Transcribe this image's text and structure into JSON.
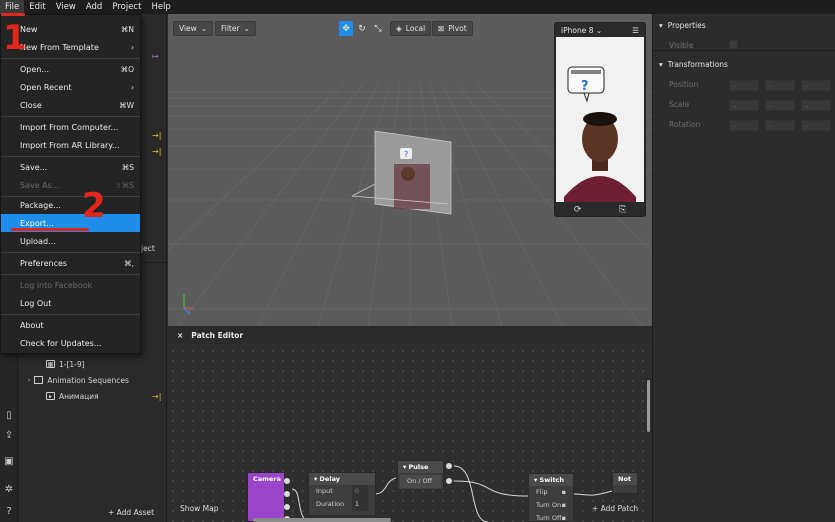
{
  "menubar": [
    "File",
    "Edit",
    "View",
    "Add",
    "Project",
    "Help"
  ],
  "file_menu": [
    {
      "label": "New",
      "shortcut": "⌘N",
      "top": 0,
      "state": "normal"
    },
    {
      "label": "New From Template",
      "shortcut": "›",
      "state": "normal"
    },
    {
      "label": "Open...",
      "shortcut": "⌘O",
      "state": "normal"
    },
    {
      "label": "Open Recent",
      "shortcut": "›",
      "state": "normal"
    },
    {
      "label": "Close",
      "shortcut": "⌘W",
      "state": "normal"
    },
    {
      "label": "Import From Computer...",
      "shortcut": "",
      "state": "normal"
    },
    {
      "label": "Import From AR Library...",
      "shortcut": "",
      "state": "normal"
    },
    {
      "label": "Save...",
      "shortcut": "⌘S",
      "state": "normal"
    },
    {
      "label": "Save As...",
      "shortcut": "⇧⌘S",
      "state": "disabled"
    },
    {
      "label": "Package...",
      "shortcut": "",
      "state": "normal"
    },
    {
      "label": "Export...",
      "shortcut": "",
      "state": "highlighted"
    },
    {
      "label": "Upload...",
      "shortcut": "",
      "state": "normal"
    },
    {
      "label": "Preferences",
      "shortcut": "⌘,",
      "state": "normal"
    },
    {
      "label": "Log into Facebook",
      "shortcut": "",
      "state": "disabled"
    },
    {
      "label": "Log Out",
      "shortcut": "",
      "state": "normal"
    },
    {
      "label": "About",
      "shortcut": "",
      "state": "normal"
    },
    {
      "label": "Check for Updates...",
      "shortcut": "",
      "state": "normal"
    }
  ],
  "annotations": {
    "step1": "1",
    "step2": "2",
    "color": "#e2261e"
  },
  "viewport": {
    "view_label": "View",
    "filter_label": "Filter",
    "local_label": "Local",
    "pivot_label": "Pivot"
  },
  "preview": {
    "device": "iPhone 8",
    "menu_icon": "☰"
  },
  "assets": {
    "texture_item": "1-[1-9]",
    "animation_folder": "Animation Sequences",
    "animation_item": "Анимация",
    "add_asset": "+ Add Asset",
    "project_cut": "ject"
  },
  "patch_editor": {
    "title": "Patch Editor",
    "show_map": "Show Map",
    "add_patch": "+ Add Patch",
    "nodes": {
      "camera": "Camera",
      "delay": {
        "title": "Delay",
        "input": "Input",
        "input_value": "0",
        "duration": "Duration",
        "duration_value": "1"
      },
      "pulse": {
        "title": "Pulse",
        "port": "On / Off"
      },
      "switch": {
        "title": "Switch",
        "flip": "Flip",
        "turn_on": "Turn On",
        "turn_off": "Turn Off"
      },
      "not": {
        "title": "Not"
      }
    }
  },
  "inspector": {
    "properties": "Properties",
    "visible": "Visible",
    "transformations": "Transformations",
    "position": "Position",
    "scale": "Scale",
    "rotation": "Rotation",
    "field_placeholder": "–"
  }
}
